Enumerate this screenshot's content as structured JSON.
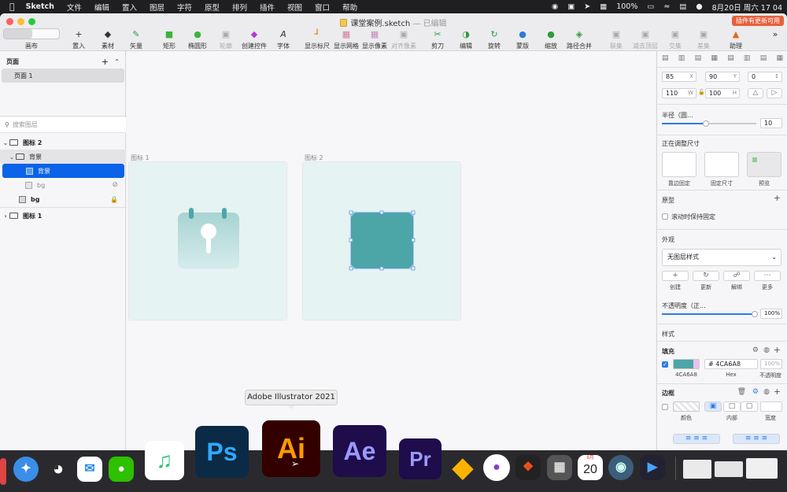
{
  "menubar": {
    "app": "Sketch",
    "items": [
      "文件",
      "编辑",
      "置入",
      "图层",
      "字符",
      "原型",
      "排列",
      "插件",
      "视图",
      "窗口",
      "帮助"
    ],
    "battery": "100%",
    "datetime": "8月20日 周六  17 04"
  },
  "window": {
    "title": "课堂案例.sketch",
    "status": "— 已编辑",
    "update_badge": "插件有更新可用"
  },
  "toolbar": {
    "canvas": "画布",
    "insert": "置入",
    "assets": "素材",
    "vector": "矢量",
    "rect": "矩形",
    "oval": "椭圆形",
    "outline": "轮廓",
    "create_control": "创建控件",
    "text": "字体",
    "rulers": "显示标尺",
    "grid": "显示网格",
    "pixels": "显示像素",
    "align_pixel": "对齐像素",
    "scissors": "剪刀",
    "edit": "编辑",
    "rotate": "旋转",
    "mask": "蒙版",
    "scale": "缩放",
    "flatten": "路径合并",
    "union": "联集",
    "subtract": "减去顶层",
    "intersect": "交集",
    "difference": "差集",
    "help": "助理"
  },
  "left": {
    "pages_label": "页面",
    "page1": "页面 1",
    "search_placeholder": "搜索图层",
    "layers": {
      "icon2": "图标 2",
      "bg_group": "背景",
      "bg_selected": "背景",
      "bg_hidden": "bg",
      "bg_locked": "bg",
      "icon1": "图标 1"
    }
  },
  "canvas": {
    "artboard1": "图标 1",
    "artboard2": "图标 2"
  },
  "right": {
    "x": "85",
    "y": "90",
    "rot": "0",
    "w": "110",
    "h": "100",
    "x_u": "X",
    "y_u": "Y",
    "w_u": "W",
    "h_u": "H",
    "radius_label": "半径（圆...",
    "radius_value": "10",
    "resizing": "正在调整尺寸",
    "pin_edge": "靠边固定",
    "fix_size": "固定尺寸",
    "preview": "预览",
    "prototype": "原型",
    "fix_scroll": "滚动时保持固定",
    "appearance": "外观",
    "no_style": "无图层样式",
    "create": "创建",
    "update": "更新",
    "detach": "解绑",
    "more": "更多",
    "opacity_label": "不透明度（正...",
    "opacity_value": "100%",
    "style": "样式",
    "fill": "填充",
    "fill_hex": "# 4CA6A8",
    "fill_caption": "4CA6A8",
    "hex_caption": "Hex",
    "opacity_caption": "不透明度",
    "opacity_field": "100%",
    "border": "边框",
    "color_caption": "颜色",
    "inside_caption": "内部",
    "width_caption": "宽度"
  },
  "dock": {
    "tooltip": "Adobe Illustrator 2021",
    "ps": "Ps",
    "ai": "Ai",
    "ae": "Ae",
    "pr": "Pr",
    "calendar_month": "8月",
    "calendar_day": "20"
  },
  "colors": {
    "accent": "#0A63E8",
    "fill": "#4CA6A8",
    "artboard": "#E6F3F3"
  }
}
